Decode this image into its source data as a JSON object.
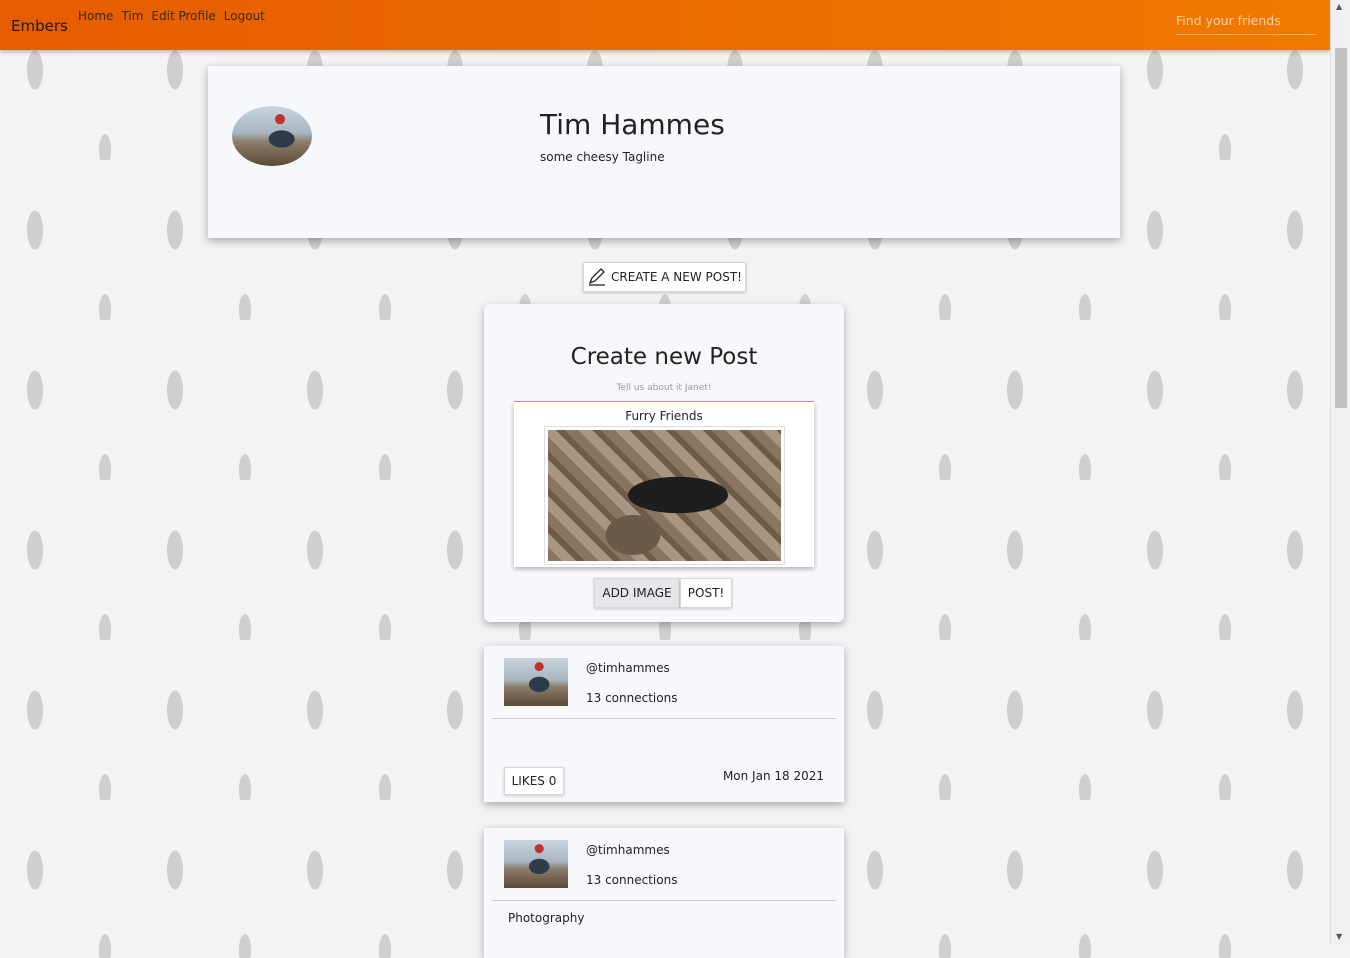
{
  "nav": {
    "brand": "Embers",
    "links": [
      "Home",
      "Tim",
      "Edit Profile",
      "Logout"
    ],
    "search_placeholder": "Find your friends"
  },
  "profile": {
    "name": "Tim Hammes",
    "tagline": "some cheesy Tagline"
  },
  "create_button": {
    "label": "CREATE A NEW POST!",
    "icon": "pen-icon"
  },
  "create_post": {
    "title": "Create new Post",
    "hint": "Tell us about it Janet!",
    "preview_caption": "Furry Friends",
    "add_image_label": "ADD IMAGE",
    "post_label": "POST!"
  },
  "posts": [
    {
      "username": "@timhammes",
      "connections": "13 connections",
      "body": "",
      "likes_label": "LIKES 0",
      "date": "Mon Jan 18 2021"
    },
    {
      "username": "@timhammes",
      "connections": "13 connections",
      "body": "Photography"
    }
  ]
}
